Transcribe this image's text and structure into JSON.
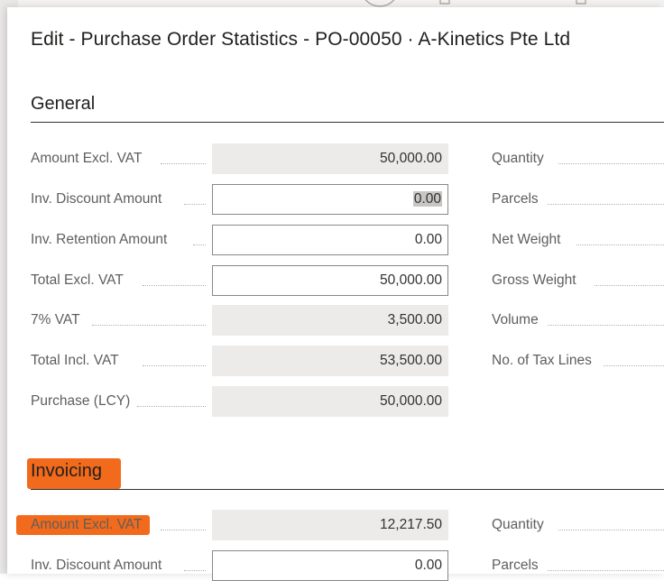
{
  "dialog": {
    "title": "Edit - Purchase Order Statistics - PO-00050 · A-Kinetics Pte Ltd"
  },
  "general": {
    "section_title": "General",
    "left_fields": [
      {
        "label": "Amount Excl. VAT",
        "value": "50,000.00",
        "editable": false
      },
      {
        "label": "Inv. Discount Amount",
        "value": "0.00",
        "editable": true,
        "selected": true
      },
      {
        "label": "Inv. Retention Amount",
        "value": "0.00",
        "editable": true
      },
      {
        "label": "Total Excl. VAT",
        "value": "50,000.00",
        "editable": true
      },
      {
        "label": "7% VAT",
        "value": "3,500.00",
        "editable": false
      },
      {
        "label": "Total Incl. VAT",
        "value": "53,500.00",
        "editable": false
      },
      {
        "label": "Purchase (LCY)",
        "value": "50,000.00",
        "editable": false
      }
    ],
    "right_fields": [
      {
        "label": "Quantity"
      },
      {
        "label": "Parcels"
      },
      {
        "label": "Net Weight"
      },
      {
        "label": "Gross Weight"
      },
      {
        "label": "Volume"
      },
      {
        "label": "No. of Tax Lines"
      }
    ]
  },
  "invoicing": {
    "section_title": "Invoicing",
    "left_fields": [
      {
        "label": "Amount Excl. VAT",
        "value": "12,217.50",
        "editable": false
      },
      {
        "label": "Inv. Discount Amount",
        "value": "0.00",
        "editable": true
      }
    ],
    "right_fields": [
      {
        "label": "Quantity"
      },
      {
        "label": "Parcels"
      }
    ]
  },
  "colors": {
    "highlight": "#f26a1b",
    "readonly_bg": "#edebe9"
  },
  "icons": [
    "edit-icon",
    "page-icon",
    "page-icon"
  ]
}
